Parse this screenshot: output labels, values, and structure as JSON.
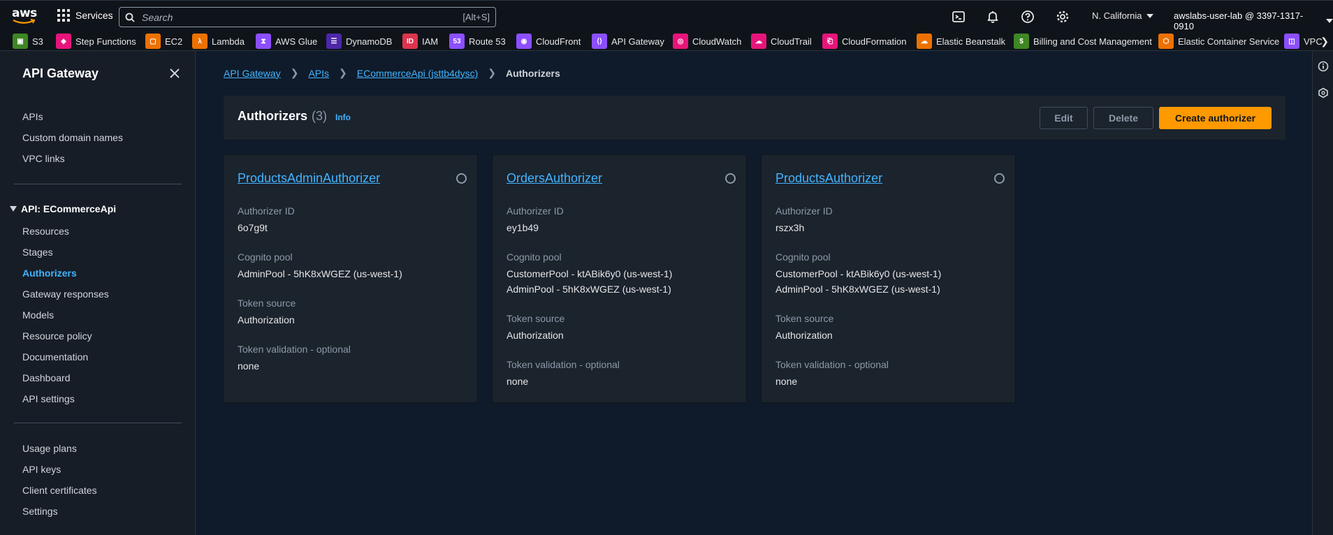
{
  "topnav": {
    "services_label": "Services",
    "search_placeholder": "Search",
    "search_shortcut": "[Alt+S]",
    "region": "N. California",
    "account": "awslabs-user-lab @ 3397-1317-0910"
  },
  "favorites": [
    {
      "label": "S3",
      "color": "#3f8624",
      "icon": "s3-icon"
    },
    {
      "label": "Step Functions",
      "color": "#e7157b",
      "icon": "step-functions-icon"
    },
    {
      "label": "EC2",
      "color": "#ed7100",
      "icon": "ec2-icon"
    },
    {
      "label": "Lambda",
      "color": "#ed7100",
      "icon": "lambda-icon"
    },
    {
      "label": "AWS Glue",
      "color": "#8c4fff",
      "icon": "glue-icon"
    },
    {
      "label": "DynamoDB",
      "color": "#4d27aa",
      "icon": "dynamodb-icon"
    },
    {
      "label": "IAM",
      "color": "#dd344c",
      "icon": "iam-icon"
    },
    {
      "label": "Route 53",
      "color": "#8c4fff",
      "icon": "route53-icon"
    },
    {
      "label": "CloudFront",
      "color": "#8c4fff",
      "icon": "cloudfront-icon"
    },
    {
      "label": "API Gateway",
      "color": "#8c4fff",
      "icon": "api-gateway-icon"
    },
    {
      "label": "CloudWatch",
      "color": "#e7157b",
      "icon": "cloudwatch-icon"
    },
    {
      "label": "CloudTrail",
      "color": "#e7157b",
      "icon": "cloudtrail-icon"
    },
    {
      "label": "CloudFormation",
      "color": "#e7157b",
      "icon": "cloudformation-icon"
    },
    {
      "label": "Elastic Beanstalk",
      "color": "#ed7100",
      "icon": "beanstalk-icon"
    },
    {
      "label": "Billing and Cost Management",
      "color": "#3f8624",
      "icon": "billing-icon"
    },
    {
      "label": "Elastic Container Service",
      "color": "#ed7100",
      "icon": "ecs-icon"
    },
    {
      "label": "VPC",
      "color": "#8c4fff",
      "icon": "vpc-icon"
    }
  ],
  "sidebar": {
    "title": "API Gateway",
    "top_items": [
      "APIs",
      "Custom domain names",
      "VPC links"
    ],
    "api_section": "API: ECommerceApi",
    "api_items": [
      "Resources",
      "Stages",
      "Authorizers",
      "Gateway responses",
      "Models",
      "Resource policy",
      "Documentation",
      "Dashboard",
      "API settings"
    ],
    "active_item": "Authorizers",
    "bottom_items": [
      "Usage plans",
      "API keys",
      "Client certificates",
      "Settings"
    ]
  },
  "breadcrumb": {
    "items": [
      "API Gateway",
      "APIs",
      "ECommerceApi (jsttb4dysc)"
    ],
    "current": "Authorizers"
  },
  "header": {
    "title": "Authorizers",
    "count": "(3)",
    "info": "Info",
    "edit": "Edit",
    "delete": "Delete",
    "create": "Create authorizer"
  },
  "labels": {
    "authorizer_id": "Authorizer ID",
    "cognito_pool": "Cognito pool",
    "token_source": "Token source",
    "token_validation": "Token validation - optional"
  },
  "authorizers": [
    {
      "name": "ProductsAdminAuthorizer",
      "id": "6o7g9t",
      "pools": [
        "AdminPool - 5hK8xWGEZ (us-west-1)"
      ],
      "token_source": "Authorization",
      "token_validation": "none"
    },
    {
      "name": "OrdersAuthorizer",
      "id": "ey1b49",
      "pools": [
        "CustomerPool - ktABik6y0 (us-west-1)",
        "AdminPool - 5hK8xWGEZ (us-west-1)"
      ],
      "token_source": "Authorization",
      "token_validation": "none"
    },
    {
      "name": "ProductsAuthorizer",
      "id": "rszx3h",
      "pools": [
        "CustomerPool - ktABik6y0 (us-west-1)",
        "AdminPool - 5hK8xWGEZ (us-west-1)"
      ],
      "token_source": "Authorization",
      "token_validation": "none"
    }
  ]
}
